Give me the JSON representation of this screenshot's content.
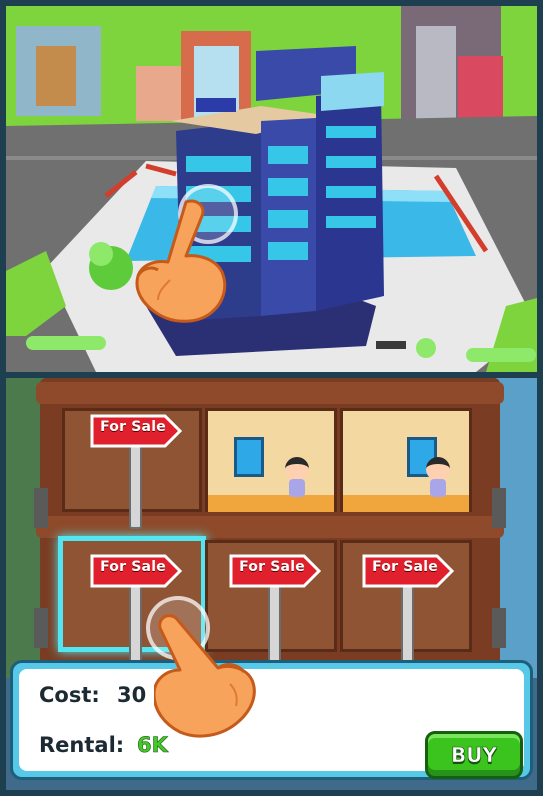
{
  "top_scene": {
    "building_colors": {
      "tower": "#2e3c8c",
      "glass": "#35c6e8",
      "roof": "#e5c9a0"
    }
  },
  "floors": {
    "upper": [
      {
        "state": "for_sale",
        "sign_text": "For Sale"
      },
      {
        "state": "occupied"
      },
      {
        "state": "occupied"
      }
    ],
    "lower": [
      {
        "state": "for_sale",
        "sign_text": "For Sale",
        "selected": true
      },
      {
        "state": "for_sale",
        "sign_text": "For Sale"
      },
      {
        "state": "for_sale",
        "sign_text": "For Sale"
      }
    ]
  },
  "info": {
    "cost_label": "Cost:",
    "cost_value": "30",
    "rental_label": "Rental:",
    "rental_value": "6K",
    "buy_label": "BUY"
  },
  "colors": {
    "sign_red": "#e0202c",
    "select_highlight": "#52e6f2",
    "buy_green": "#3cc41e",
    "panel_blue": "#57c8e8"
  }
}
